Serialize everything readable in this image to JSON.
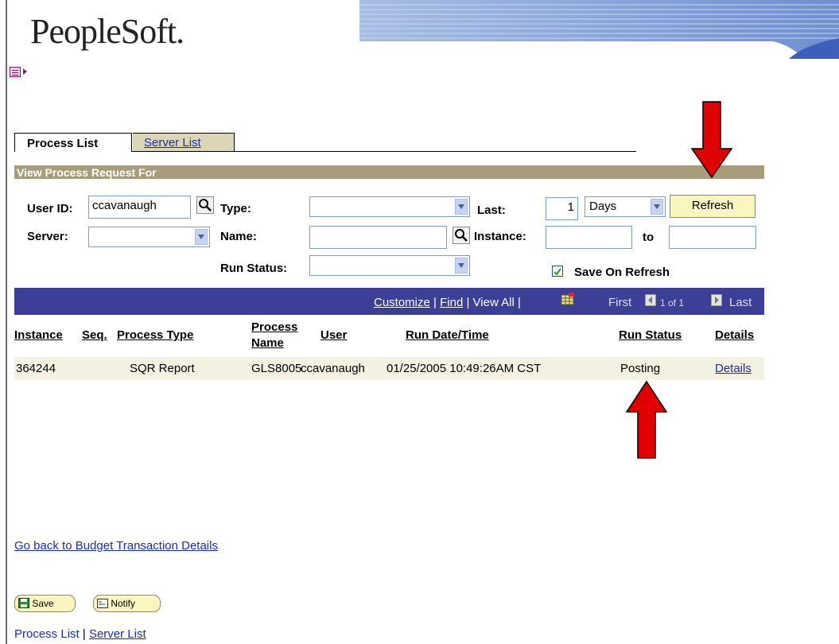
{
  "brand": {
    "logo": "PeopleSoft."
  },
  "tabs": [
    {
      "label": "Process List"
    },
    {
      "label": "Server List"
    }
  ],
  "section_title": "View Process Request For",
  "form": {
    "user_id_label": "User ID:",
    "user_id_value": "ccavanaugh",
    "type_label": "Type:",
    "type_value": "",
    "last_label": "Last:",
    "last_value": "1",
    "days_value": "Days",
    "refresh_label": "Refresh",
    "server_label": "Server:",
    "server_value": "",
    "name_label": "Name:",
    "name_value": "",
    "instance_label": "Instance:",
    "instance_from": "",
    "to_label": "to",
    "instance_to": "",
    "run_status_label": "Run Status:",
    "run_status_value": "",
    "save_on_refresh_label": "Save On Refresh",
    "save_on_refresh_checked": true
  },
  "grid": {
    "customize": "Customize",
    "find": "Find",
    "view_all": "View All",
    "sep": "|",
    "first": "First",
    "page_info": "1 of 1",
    "last": "Last",
    "headers": {
      "instance": "Instance",
      "seq": "Seq.",
      "process_type": "Process Type",
      "process_name_1": "Process",
      "process_name_2": "Name",
      "user": "User",
      "run_date_time": "Run Date/Time",
      "run_status": "Run Status",
      "details": "Details"
    },
    "rows": [
      {
        "instance": "364244",
        "seq": "",
        "process_type": "SQR Report",
        "process_name": "GLS8005",
        "user": "ccavanaugh",
        "run_date_time": "01/25/2005 10:49:26AM CST",
        "run_status": "Posting",
        "details": "Details"
      }
    ]
  },
  "links": {
    "go_back": "Go back to Budget Transaction Details"
  },
  "buttons": {
    "save": "Save",
    "notify": "Notify"
  },
  "footer": {
    "process_list": "Process List",
    "sep": "|",
    "server_list": "Server List"
  },
  "colors": {
    "annotation_arrow": "#e00000",
    "grid_header": "#3b3f96",
    "section_bar": "#a79d7c",
    "link": "#1a2fa8"
  }
}
